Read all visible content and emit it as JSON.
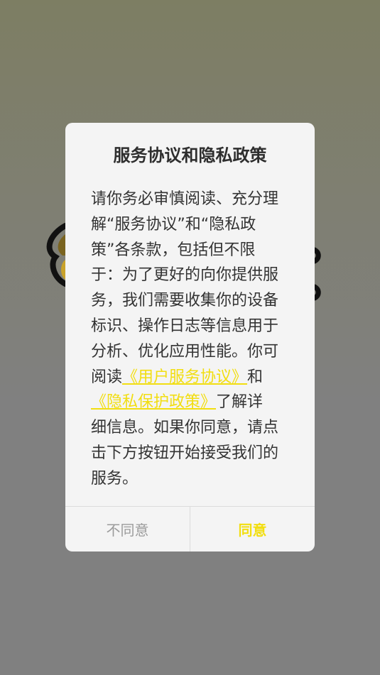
{
  "dialog": {
    "title": "服务协议和隐私政策",
    "body_before_links": "请你务必审慎阅读、充分理解“服务协议”和“隐私政策”各条款，包括但不限于：为了更好的向你提供服务，我们需要收集你的设备标识、操作日志等信息用于分析、优化应用性能。你可阅读",
    "user_agreement_link": "《用户服务协议》",
    "conjunction": "和",
    "privacy_policy_link": "《隐私保护政策》",
    "body_after_links": "了解详细信息。如果你同意，请点击下方按钮开始接受我们的服务。",
    "disagree_label": "不同意",
    "agree_label": "同意"
  },
  "colors": {
    "accent": "#f2de10",
    "overlay": "#808080",
    "dialog_bg": "#f4f4f4",
    "muted_text": "#9b9b9b"
  }
}
